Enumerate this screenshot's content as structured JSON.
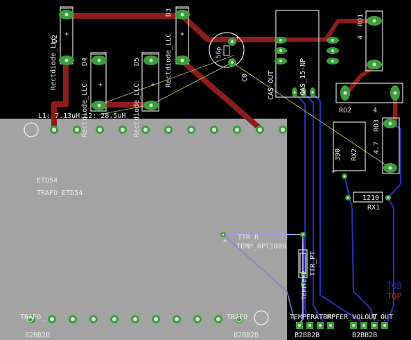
{
  "board": {
    "background": "#000000",
    "trafo_fill": "#a3a3a3",
    "colors": {
      "top_layer": "#8f1c1c",
      "bottom_layer": "#2b2bb8",
      "pad": "#3a9f3a",
      "airwire": "#c8c86a",
      "silkscreen": "#e8e8e8"
    }
  },
  "labels": {
    "d2": "D2",
    "d3": "D3",
    "d4": "D4",
    "d5": "D5",
    "rect_d2": "Rectdiode_LLC",
    "rect_d3": "Rectdiode_LLC",
    "rect_d4": "Rectdiode_LLC",
    "rect_d5": "Rectdiode_LLC",
    "c0_value": "56p",
    "c0_name": "C0",
    "cas_out": "CAS_OUT",
    "cas_15": "CAS_15-NP",
    "ro1": "RO1",
    "ro1_val": "4",
    "ro2": "RO2",
    "ro2_val": "4",
    "ro3": "RO3",
    "ro3_val": "4.7",
    "rx2": "RX2",
    "rx2_val": "390",
    "rx1": "RX1",
    "rx1_val": "1210",
    "l1": "L1: 7.13uH L2: 28.5uH",
    "etd54": "ETD54",
    "trafo_etd54": "TRAFO_ETD54",
    "ttr_r": "TTR_R",
    "temp_rpt": "TEMP_RPT1000",
    "ttr_pt": "TTR_PT",
    "temp_vert": "TEMP",
    "temp_vert2": "TEMP",
    "trafo_left": "TRAFO_",
    "trafo_right": "TRAFO_",
    "b2bb2b_left": "B2BB2B",
    "b2bb2b_right": "B2BB2B",
    "conn_top_label": "TEMPERATUR",
    "conn_top_label2": "TEMPFER_VOLOUT",
    "v_out": "V_OUT",
    "b2bb_bottom_1": "B2BB2B",
    "b2bb_bottom_2": "B2BB2B",
    "layer_bottom": "TOB",
    "layer_top": "TOP"
  }
}
